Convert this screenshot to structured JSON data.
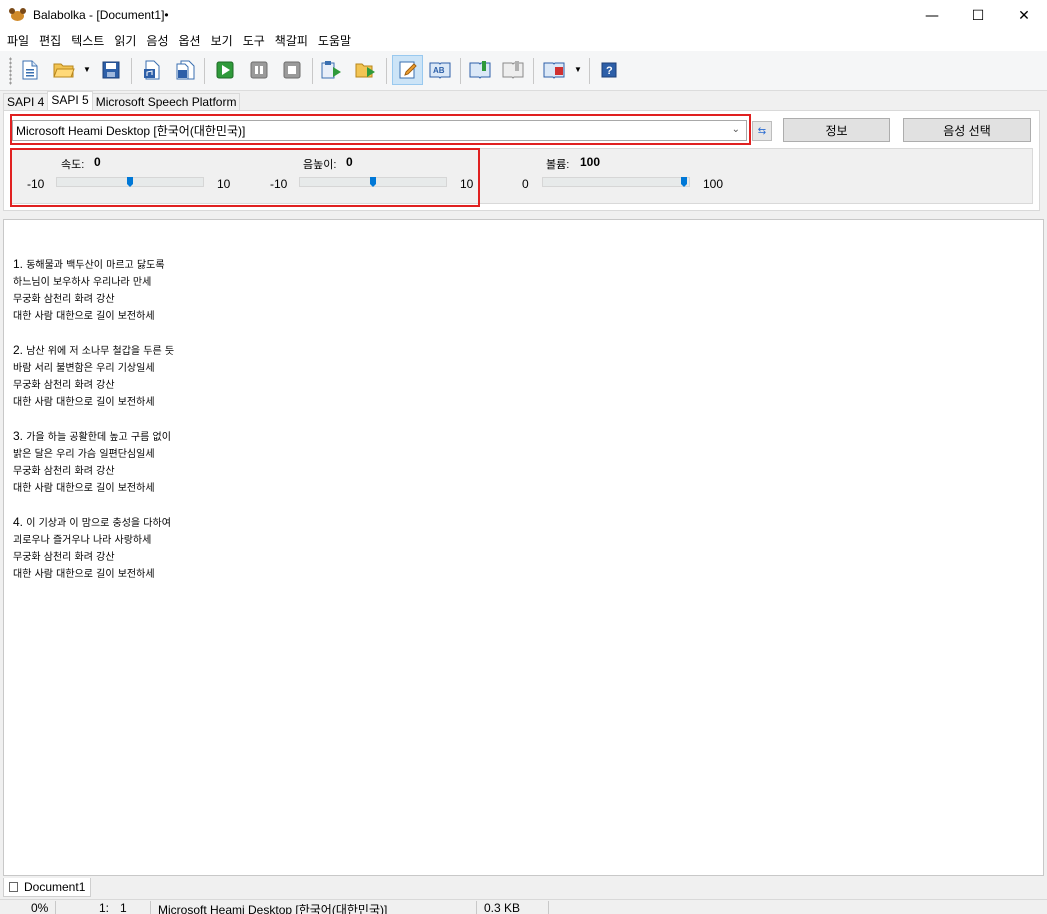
{
  "window": {
    "title": "Balabolka - [Document1]•"
  },
  "menu": [
    "파일",
    "편집",
    "텍스트",
    "읽기",
    "음성",
    "옵션",
    "보기",
    "도구",
    "책갈피",
    "도움말"
  ],
  "toolbar_icons": [
    "new-document-icon",
    "open-folder-icon",
    "save-icon",
    "export-audio-icon",
    "batch-export-icon",
    "play-icon",
    "pause-icon",
    "stop-icon",
    "read-clipboard-icon",
    "read-file-icon",
    "edit-text-icon",
    "spell-check-icon",
    "bookmark-add-icon",
    "bookmark-icon",
    "dictionary-icon",
    "help-icon"
  ],
  "tabs": [
    "SAPI 4",
    "SAPI 5",
    "Microsoft Speech Platform"
  ],
  "selected_tab": "SAPI 5",
  "voice": {
    "selected": "Microsoft Heami Desktop [한국어(대한민국)]",
    "info_button": "정보",
    "select_button": "음성 선택"
  },
  "params": {
    "rate": {
      "label": "속도:",
      "value": "0",
      "min": "-10",
      "max": "10",
      "level": 0
    },
    "pitch": {
      "label": "음높이:",
      "value": "0",
      "min": "-10",
      "max": "10",
      "level": 0
    },
    "volume": {
      "label": "볼륨:",
      "value": "100",
      "min": "0",
      "max": "100",
      "level": 100
    }
  },
  "document": {
    "verses": [
      {
        "num": "1.",
        "lines": [
          "동해물과 백두산이 마르고 닳도록",
          "하느님이 보우하사 우리나라 만세",
          "무궁화 삼천리 화려 강산",
          "대한 사람 대한으로 길이 보전하세"
        ]
      },
      {
        "num": "2.",
        "lines": [
          "남산 위에 저 소나무 철갑을 두른 듯",
          "바람 서리 불변함은 우리 기상일세",
          "무궁화 삼천리 화려 강산",
          "대한 사람 대한으로 길이 보전하세"
        ]
      },
      {
        "num": "3.",
        "lines": [
          "가을 하늘 공활한데 높고 구름 없이",
          "밝은 달은 우리 가슴 일편단심일세",
          "무궁화 삼천리 화려 강산",
          "대한 사람 대한으로 길이 보전하세"
        ]
      },
      {
        "num": "4.",
        "lines": [
          "이 기상과 이 맘으로 충성을 다하여",
          "괴로우나 즐거우나 나라 사랑하세",
          "무궁화 삼천리 화려 강산",
          "대한 사람 대한으로 길이 보전하세"
        ]
      }
    ]
  },
  "doc_tab": "Document1",
  "status": {
    "progress": "0%",
    "line": "1:",
    "col": "1",
    "voice": "Microsoft Heami Desktop [한국어(대한민국)]",
    "size": "0.3 KB"
  },
  "colors": {
    "accent": "#0078d7",
    "highlight_box": "#e02020"
  }
}
